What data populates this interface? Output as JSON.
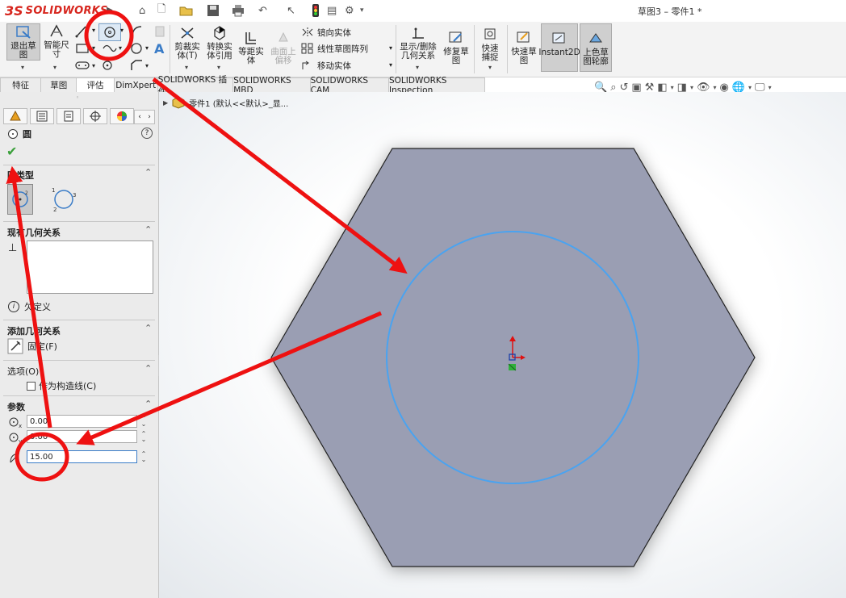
{
  "app": {
    "logo_mark": "3S",
    "logo_text": "SOLIDWORKS",
    "document_title": "草图3 – 零件1 *"
  },
  "quick_access": {
    "icons": [
      "home-icon",
      "new-icon",
      "open-icon",
      "save-icon",
      "print-icon",
      "undo-icon",
      "select-icon",
      "rebuild-icon",
      "file-props-icon",
      "options-icon"
    ]
  },
  "ribbon": {
    "exit_sketch": "退出草图",
    "smart_dimension": "智能尺寸",
    "trim_entities": "剪裁实体(T)",
    "convert_entities": "转换实体引用",
    "offset_entities": "等距实体",
    "offset_on_surface": "曲面上偏移",
    "mirror_entities": "镜向实体",
    "linear_sketch_pattern": "线性草图阵列",
    "move_entities": "移动实体",
    "display_delete_relations": "显示/删除几何关系",
    "repair_sketch": "修复草图",
    "quick_snaps": "快速捕捉",
    "rapid_sketch": "快速草图",
    "instant2d": "Instant2D",
    "shaded_sketch_contours": "上色草图轮廓"
  },
  "tabs": [
    {
      "label": "特征",
      "active": false
    },
    {
      "label": "草图",
      "active": true
    },
    {
      "label": "评估",
      "active": false
    },
    {
      "label": "DimXpert",
      "active": false
    },
    {
      "label": "SOLIDWORKS 插件",
      "active": false
    },
    {
      "label": "SOLIDWORKS MBD",
      "active": false
    },
    {
      "label": "SOLIDWORKS CAM",
      "active": false
    },
    {
      "label": "SOLIDWORKS Inspection",
      "active": false
    }
  ],
  "tree": {
    "breadcrumb": "零件1 (默认<<默认>_显..."
  },
  "property_manager": {
    "title": "圆",
    "help": "?",
    "sections": {
      "circle_type": "圆类型",
      "existing_relations": "现有几何关系",
      "under_defined": "欠定义",
      "add_relations": "添加几何关系",
      "fix": "固定(F)",
      "options": "选项(O)",
      "construction": "作为构造线(C)",
      "parameters": "参数"
    },
    "params": {
      "center_x": "0.00",
      "center_y": "0.00",
      "radius": "15.00"
    }
  },
  "colors": {
    "hexagon_fill": "#9a9eb3",
    "circle": "#4aa3f0",
    "annotation": "#ee1111",
    "brand": "#d7261e"
  }
}
